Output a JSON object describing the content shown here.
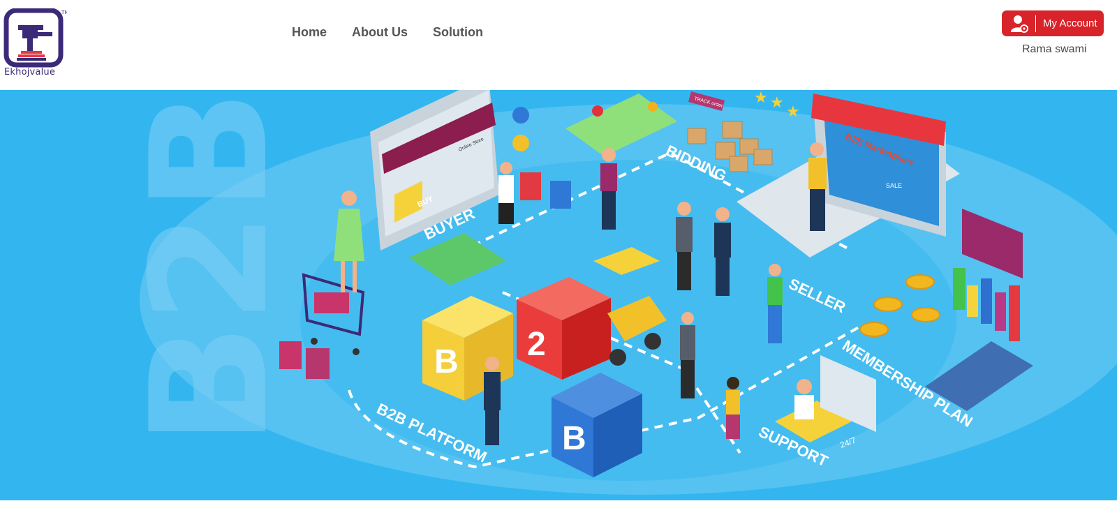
{
  "brand": {
    "name": "Ekhojvalue",
    "tm": "™"
  },
  "nav": {
    "items": [
      {
        "label": "Home"
      },
      {
        "label": "About Us"
      },
      {
        "label": "Solution"
      }
    ]
  },
  "account": {
    "button_label": "My Account",
    "username": "Rama swami"
  },
  "hero": {
    "watermark": "B2B",
    "labels": {
      "buyer": "BUYER",
      "bidding": "BIDDING",
      "seller": "SELLER",
      "membership": "MEMBERSHIP PLAN",
      "support": "SUPPORT",
      "support_hours": "24/7",
      "platform": "B2B PLATFORM",
      "marketplace": "B2B Marketplace",
      "online_store": "Online Store",
      "buy_tag": "BUY",
      "sale_tag": "SALE",
      "track_tag": "TRACK order"
    },
    "blocks": [
      "B",
      "2",
      "B"
    ],
    "colors": {
      "sky": "#33b6ef",
      "accent_red": "#d8232a",
      "brand_purple": "#3b2a78"
    }
  }
}
